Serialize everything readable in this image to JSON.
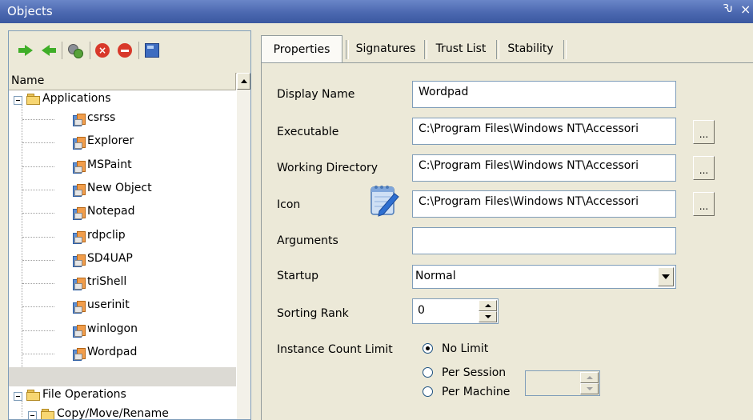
{
  "window": {
    "title": "Objects",
    "pin_glyph": "Ԅ",
    "close_glyph": "×"
  },
  "toolbar": {
    "icons": [
      "arrow-right-icon",
      "arrow-left-icon",
      "gears-icon",
      "delete-icon",
      "remove-icon",
      "export-icon"
    ]
  },
  "tree": {
    "column_header": "Name",
    "root": "Applications",
    "apps": [
      "csrss",
      "Explorer",
      "MSPaint",
      "New Object",
      "Notepad",
      "rdpclip",
      "SD4UAP",
      "triShell",
      "userinit",
      "winlogon",
      "Wordpad"
    ],
    "selected": "Wordpad",
    "folder2": "File Operations",
    "subfolder": "Copy/Move/Rename"
  },
  "tabs": [
    "Properties",
    "Signatures",
    "Trust List",
    "Stability"
  ],
  "active_tab": "Properties",
  "form": {
    "display_name": {
      "label": "Display Name",
      "value": "Wordpad"
    },
    "executable": {
      "label": "Executable",
      "value": "C:\\Program Files\\Windows NT\\Accessori"
    },
    "working_directory": {
      "label": "Working Directory",
      "value": "C:\\Program Files\\Windows NT\\Accessori"
    },
    "icon": {
      "label": "Icon",
      "value": "C:\\Program Files\\Windows NT\\Accessori"
    },
    "arguments": {
      "label": "Arguments",
      "value": ""
    },
    "startup": {
      "label": "Startup",
      "value": "Normal"
    },
    "sorting_rank": {
      "label": "Sorting Rank",
      "value": "0"
    },
    "instance_count_limit": {
      "label": "Instance Count Limit",
      "options": [
        "No Limit",
        "Per Session",
        "Per Machine"
      ],
      "selected": "No Limit"
    },
    "browse_label": "..."
  },
  "colors": {
    "titlebar": "#4b68b0",
    "selection": "#dcdad4",
    "background": "#ece9d8"
  }
}
